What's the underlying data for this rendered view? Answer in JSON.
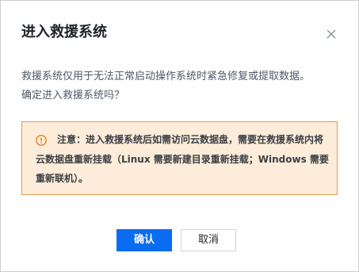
{
  "dialog": {
    "title": "进入救援系统",
    "close_icon": "close-icon",
    "description_line1": "救援系统仅用于无法正常启动操作系统时紧急修复或提取数据。",
    "description_line2": "确定进入救援系统吗？",
    "notice": {
      "icon": "warning-circle-icon",
      "text": "注意：进入救援系统后如需访问云数据盘，需要在救援系统内将云数据盘重新挂载（Linux 需要新建目录重新挂载；Windows 需要重新联机）。"
    },
    "buttons": {
      "confirm_label": "确认",
      "cancel_label": "取消"
    },
    "colors": {
      "primary": "#0a6cf0",
      "notice_bg": "#fcecd9",
      "notice_border": "#e09c52",
      "warning_icon": "#e07b1a"
    }
  }
}
